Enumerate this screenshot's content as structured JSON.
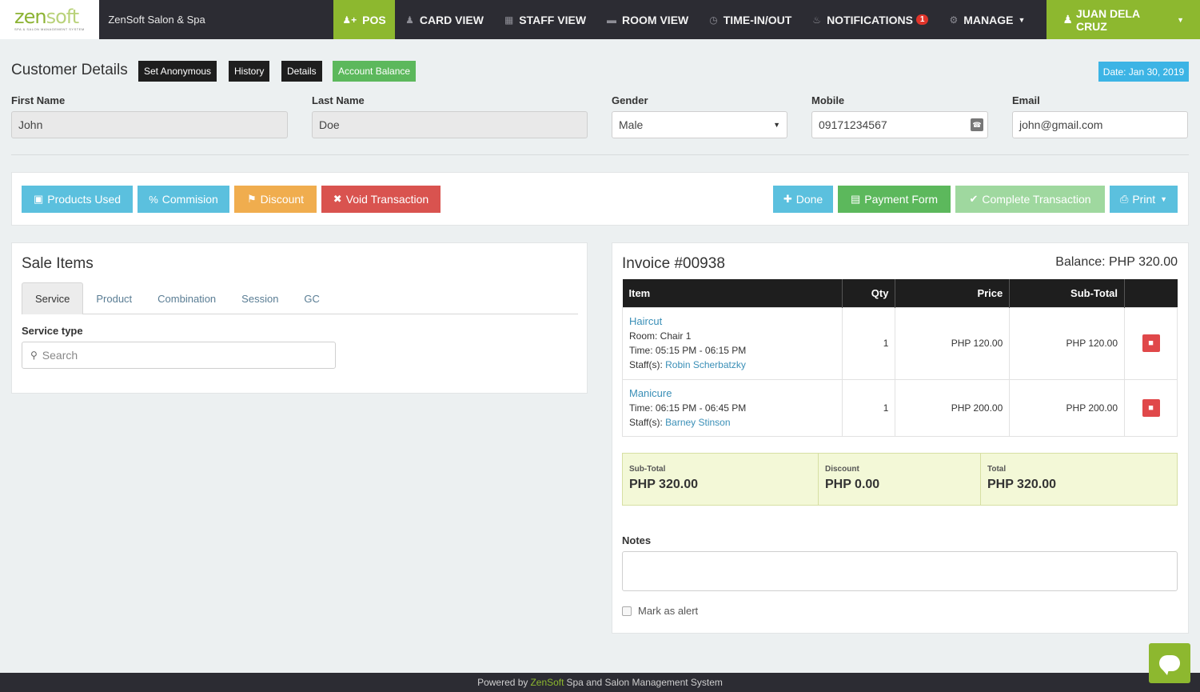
{
  "topnav": {
    "logo_main": "zen",
    "logo_accent": "soft",
    "logo_sub": "SPA & SALON MANAGEMENT SYSTEM",
    "brand": "ZenSoft Salon & Spa",
    "items": [
      {
        "label": "POS",
        "icon": "user-plus-icon"
      },
      {
        "label": "CARD VIEW",
        "icon": "users-icon"
      },
      {
        "label": "STAFF VIEW",
        "icon": "calendar-icon"
      },
      {
        "label": "ROOM VIEW",
        "icon": "bed-icon"
      },
      {
        "label": "TIME-IN/OUT",
        "icon": "clock-icon"
      },
      {
        "label": "NOTIFICATIONS",
        "icon": "bell-icon",
        "badge": "1"
      },
      {
        "label": "MANAGE",
        "icon": "gear-icon"
      }
    ],
    "user": "JUAN DELA CRUZ"
  },
  "customer": {
    "title": "Customer Details",
    "buttons": [
      "Set Anonymous",
      "History",
      "Details",
      "Account Balance"
    ],
    "date": "Date: Jan 30, 2019",
    "first_name_label": "First Name",
    "first_name": "John",
    "last_name_label": "Last Name",
    "last_name": "Doe",
    "gender_label": "Gender",
    "gender": "Male",
    "mobile_label": "Mobile",
    "mobile": "09171234567",
    "email_label": "Email",
    "email": "john@gmail.com"
  },
  "actions": {
    "products_used": "Products Used",
    "commision": "Commision",
    "discount": "Discount",
    "void": "Void Transaction",
    "done": "Done",
    "payment_form": "Payment Form",
    "complete": "Complete Transaction",
    "print": "Print"
  },
  "sale": {
    "title": "Sale Items",
    "tabs": [
      "Service",
      "Product",
      "Combination",
      "Session",
      "GC"
    ],
    "service_type_label": "Service type",
    "search_placeholder": "Search"
  },
  "invoice": {
    "title": "Invoice #00938",
    "balance": "Balance: PHP 320.00",
    "headers": {
      "item": "Item",
      "qty": "Qty",
      "price": "Price",
      "subtotal": "Sub-Total"
    },
    "rows": [
      {
        "name": "Haircut",
        "room": "Room: Chair 1",
        "time": "Time: 05:15 PM - 06:15 PM",
        "staff_label": "Staff(s):",
        "staff": "Robin Scherbatzky",
        "qty": "1",
        "price": "PHP 120.00",
        "subtotal": "PHP 120.00"
      },
      {
        "name": "Manicure",
        "time": "Time: 06:15 PM - 06:45 PM",
        "staff_label": "Staff(s):",
        "staff": "Barney Stinson",
        "qty": "1",
        "price": "PHP 200.00",
        "subtotal": "PHP 200.00"
      }
    ],
    "totals": {
      "subtotal_label": "Sub-Total",
      "subtotal": "PHP 320.00",
      "discount_label": "Discount",
      "discount": "PHP 0.00",
      "total_label": "Total",
      "total": "PHP 320.00"
    },
    "notes_label": "Notes",
    "notes_value": "",
    "mark_alert": "Mark as alert"
  },
  "footer": {
    "prefix": "Powered by",
    "brand": "ZenSoft",
    "suffix": "Spa and Salon Management System"
  },
  "colors": {
    "accent_green": "#8db82f",
    "nav_dark": "#2c2c33",
    "info_blue": "#5bc0de",
    "warning_orange": "#f0ad4e",
    "danger_red": "#d9534f",
    "success_green": "#5cb85c"
  }
}
